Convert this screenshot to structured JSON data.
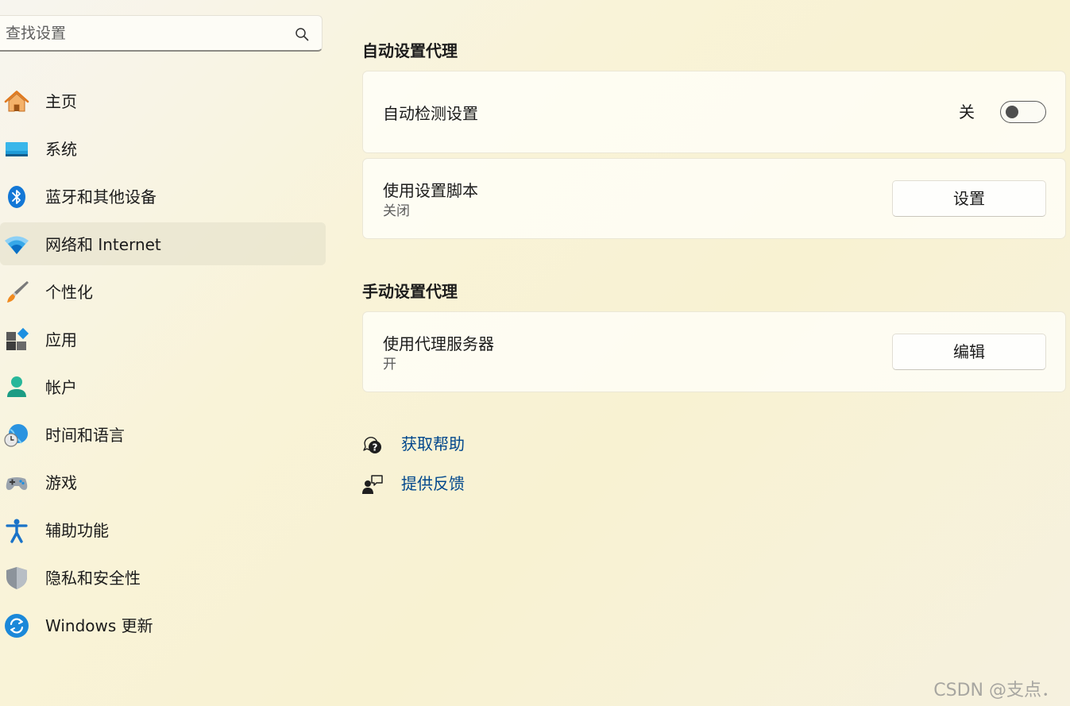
{
  "search": {
    "placeholder": "查找设置"
  },
  "sidebar": {
    "items": [
      {
        "label": "主页",
        "icon": "home-icon"
      },
      {
        "label": "系统",
        "icon": "system-icon"
      },
      {
        "label": "蓝牙和其他设备",
        "icon": "bluetooth-icon"
      },
      {
        "label": "网络和 Internet",
        "icon": "wifi-icon",
        "active": true
      },
      {
        "label": "个性化",
        "icon": "brush-icon"
      },
      {
        "label": "应用",
        "icon": "apps-icon"
      },
      {
        "label": "帐户",
        "icon": "account-icon"
      },
      {
        "label": "时间和语言",
        "icon": "globe-clock-icon"
      },
      {
        "label": "游戏",
        "icon": "gamepad-icon"
      },
      {
        "label": "辅助功能",
        "icon": "accessibility-icon"
      },
      {
        "label": "隐私和安全性",
        "icon": "shield-icon"
      },
      {
        "label": "Windows 更新",
        "icon": "update-icon"
      }
    ]
  },
  "auto_proxy": {
    "title": "自动设置代理",
    "detect": {
      "label": "自动检测设置",
      "state": "关",
      "on": false
    },
    "script": {
      "label": "使用设置脚本",
      "status": "关闭",
      "button": "设置"
    }
  },
  "manual_proxy": {
    "title": "手动设置代理",
    "server": {
      "label": "使用代理服务器",
      "status": "开",
      "button": "编辑"
    }
  },
  "links": {
    "help": "获取帮助",
    "feedback": "提供反馈"
  },
  "watermark": "CSDN @支点．",
  "colors": {
    "link": "#00478c",
    "accent": "#0067c0"
  }
}
